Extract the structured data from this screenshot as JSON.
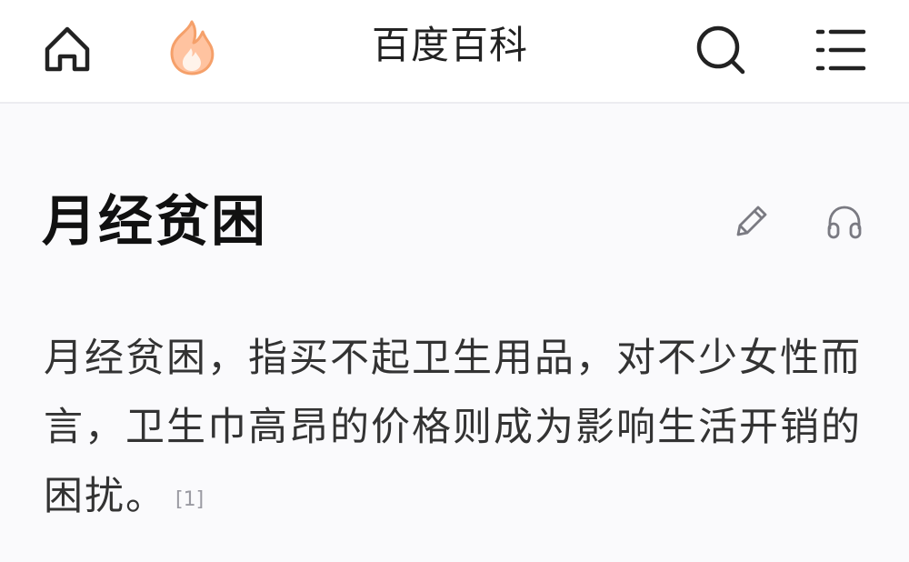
{
  "header": {
    "title": "百度百科",
    "icons": {
      "home": "home-icon",
      "hot": "flame-icon",
      "search": "search-icon",
      "menu": "menu-icon"
    },
    "colors": {
      "hot_fill": "#ffb488",
      "hot_stroke": "#f5a06a",
      "icon": "#222222"
    }
  },
  "entry": {
    "title": "月经贫困",
    "actions": {
      "edit": "pencil-icon",
      "listen": "headphones-icon"
    },
    "summary": "月经贫困，指买不起卫生用品，对不少女性而言，卫生巾高昂的价格则成为影响生活开销的困扰。",
    "reference": "[1]"
  }
}
